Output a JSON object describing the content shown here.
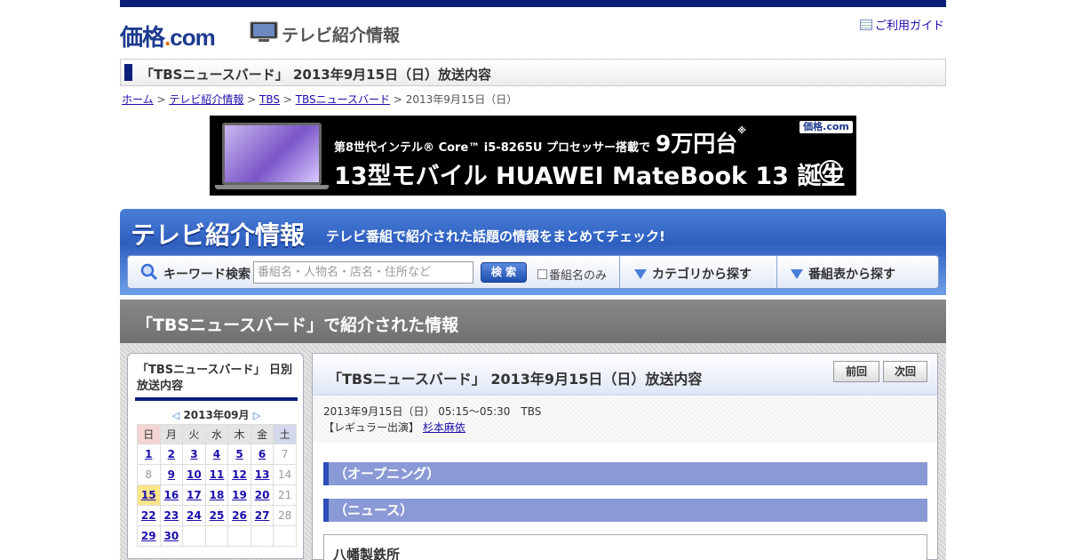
{
  "header": {
    "logo_text": "価格",
    "logo_dot": ".",
    "logo_com": "com",
    "section_title": "テレビ紹介情報",
    "guide_link": "ご利用ガイド"
  },
  "page_title": "「TBSニュースバード」 2013年9月15日（日）放送内容",
  "breadcrumb": {
    "items": [
      "ホーム",
      "テレビ紹介情報",
      "TBS",
      "TBSニュースバード"
    ],
    "sep": " > ",
    "current": "2013年9月15日（日）"
  },
  "banner": {
    "line1_a": "第8世代インテル® Core™ i5-8265U プロセッサー搭載で",
    "line1_b": "9万円台",
    "line1_note": "※",
    "line2": "13型モバイル HUAWEI MateBook 13 誕生",
    "logo": "価格.com",
    "arrow": "›"
  },
  "tv_panel": {
    "title": "テレビ紹介情報",
    "subtitle": "テレビ番組で紹介された話題の情報をまとめてチェック!",
    "keyword_label": "キーワード検索",
    "search_placeholder": "番組名・人物名・店名・住所など",
    "search_button": "検 索",
    "checkbox_label": "番組名のみ",
    "category_dropdown": "カテゴリから探す",
    "schedule_dropdown": "番組表から探す"
  },
  "section_bar": "「TBSニュースバード」で紹介された情報",
  "calendar": {
    "title": "「TBSニュースバード」 日別放送内容",
    "month": "2013年09月",
    "prev": "◁",
    "next": "▷",
    "weekdays": [
      "日",
      "月",
      "火",
      "水",
      "木",
      "金",
      "土"
    ],
    "weeks": [
      [
        "1",
        "2",
        "3",
        "4",
        "5",
        "6",
        "7"
      ],
      [
        "8",
        "9",
        "10",
        "11",
        "12",
        "13",
        "14"
      ],
      [
        "15",
        "16",
        "17",
        "18",
        "19",
        "20",
        "21"
      ],
      [
        "22",
        "23",
        "24",
        "25",
        "26",
        "27",
        "28"
      ],
      [
        "29",
        "30",
        "",
        "",
        "",
        "",
        ""
      ]
    ],
    "today": "15",
    "inactive_days": [
      "7",
      "8",
      "14",
      "21",
      "28"
    ]
  },
  "main": {
    "title": "「TBSニュースバード」 2013年9月15日（日）放送内容",
    "prev_button": "前回",
    "next_button": "次回",
    "broadcast_info": "2013年9月15日（日） 05:15～05:30　TBS",
    "regular_label": "【レギュラー出演】",
    "regular_cast": "杉本麻依",
    "sections": [
      "（オープニング）",
      "（ニュース）"
    ],
    "item_title": "八幡製鉄所"
  },
  "colors": {
    "navy": "#0b1e7a",
    "panel_blue": "#2e5fc0",
    "section_purple": "#8a9ad6",
    "link": "#1a0dab",
    "today_highlight": "#fce58a"
  }
}
